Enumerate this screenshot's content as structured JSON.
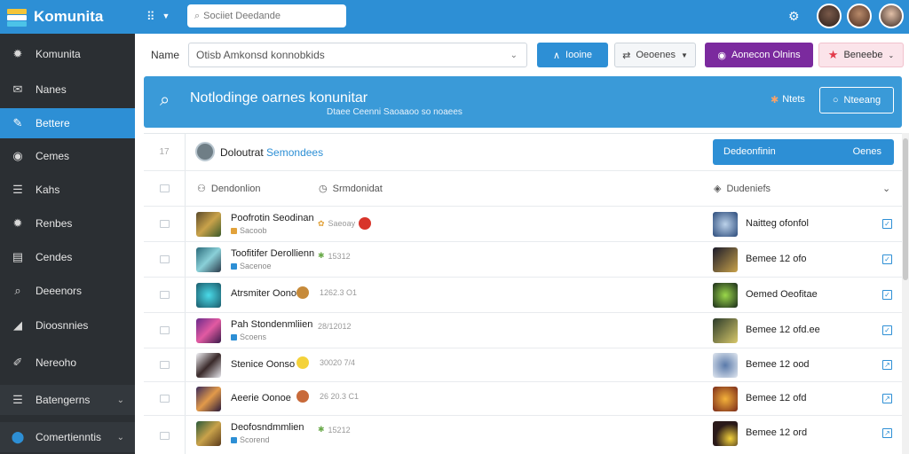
{
  "app": {
    "title": "Komunita",
    "search_placeholder": "Sociiet Deedande"
  },
  "colors": {
    "primary": "#2d8fd5",
    "sidebar_bg": "#2b2f33",
    "purple": "#7b2a9e",
    "pink": "#fbe4ea",
    "banner": "#3a9ad8"
  },
  "sidebar": {
    "items": [
      {
        "label": "Komunita",
        "icon": "gear-icon"
      },
      {
        "label": "Nanes",
        "icon": "mail-icon"
      },
      {
        "label": "Bettere",
        "icon": "pencil-icon"
      },
      {
        "label": "Cemes",
        "icon": "circle-icon"
      },
      {
        "label": "Kahs",
        "icon": "list-icon"
      },
      {
        "label": "Renbes",
        "icon": "gear-icon"
      },
      {
        "label": "Cendes",
        "icon": "box-icon"
      },
      {
        "label": "Deeenors",
        "icon": "search-icon"
      },
      {
        "label": "Dioosnnies",
        "icon": "megaphone-icon"
      },
      {
        "label": "Nereoho",
        "icon": "wrench-icon"
      },
      {
        "label": "Batengerns",
        "icon": "list-icon"
      },
      {
        "label": "Comertienntis",
        "icon": "toggle-icon"
      }
    ]
  },
  "filter": {
    "label": "Name",
    "select_value": "Otisb Amkonsd konnobkids",
    "btn_primary": "Iooine",
    "btn_secondary": "Oeoenes",
    "btn_purple": "Aonecon Olnins",
    "btn_pink": "Beneebe"
  },
  "banner": {
    "title": "Notlodinge oarnes konunitar",
    "subtitle": "Dtaee Ceenni Saoaaoo so noaees",
    "note": "Ntets",
    "button": "Nteeang"
  },
  "table": {
    "header_title": "Doloutrat",
    "header_title_accent": "Semondees",
    "header_btn_left": "Dedeonfinin",
    "header_btn_right": "Oenes",
    "row_number": "17",
    "col_1": "Dendonlion",
    "col_2": "Srmdonidat",
    "col_3": "Dudeniefs",
    "rows": [
      {
        "name": "Poofrotin Seodinan",
        "meta": "Sacoob",
        "stat": "Saeoay",
        "right": "Naitteg ofonfol",
        "checked": true
      },
      {
        "name": "Toofitifer Derollienn",
        "meta": "Sacenoe",
        "stat": "15312",
        "right": "Bemee 12 ofo",
        "checked": true
      },
      {
        "name": "Atrsmiter Oonod",
        "meta": "",
        "stat": "1262.3 O1",
        "right": "Oemed Oeofitae",
        "checked": true
      },
      {
        "name": "Pah Stondenmliien",
        "meta": "Scoens",
        "stat": "28/12012",
        "right": "Bemee 12 ofd.ee",
        "checked": true
      },
      {
        "name": "Stenice Oonso",
        "meta": "",
        "stat": "30020 7/4",
        "right": "Bemee 12 ood",
        "checked": false
      },
      {
        "name": "Aeerie Oonoe",
        "meta": "",
        "stat": "26 20.3 C1",
        "right": "Bemee 12 ofd",
        "checked": false
      },
      {
        "name": "Deofosndmmlien",
        "meta": "Scorend",
        "stat": "15212",
        "right": "Bemee 12 ord",
        "checked": false
      }
    ]
  }
}
